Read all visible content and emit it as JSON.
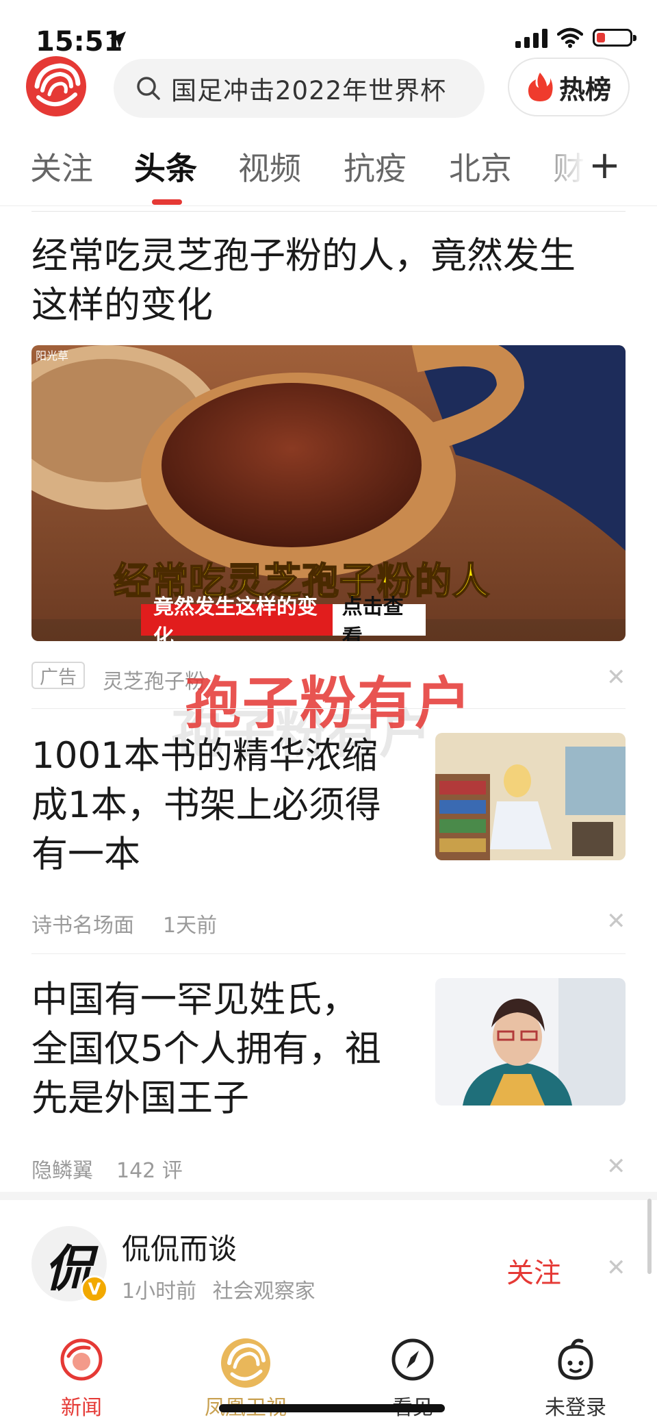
{
  "status_bar": {
    "time": "15:51"
  },
  "header": {
    "search_placeholder": "国足冲击2022年世界杯",
    "hot_label": "热榜"
  },
  "tabs": [
    {
      "label": "关注"
    },
    {
      "label": "头条"
    },
    {
      "label": "视频"
    },
    {
      "label": "抗疫"
    },
    {
      "label": "北京"
    },
    {
      "label": "财"
    }
  ],
  "active_tab": "头条",
  "feed": {
    "ad": {
      "title_line1": "经常吃灵芝孢子粉的人，竟然发生",
      "title_line2": "这样的变化",
      "image_watermark": "阳光草",
      "image_caption_main": "经常吃灵芝孢子粉的人",
      "image_caption_sub": "竟然发生这样的变化",
      "image_cta": "点击查看",
      "badge": "广告",
      "source": "灵芝孢子粉"
    },
    "overlay_text": "孢子粉有户",
    "articles": [
      {
        "title_lines": [
          "1001本书的精华浓缩",
          "成1本，书架上必须得",
          "有一本"
        ],
        "source": "诗书名场面",
        "time": "1天前"
      },
      {
        "title_lines": [
          "中国有一罕见姓氏，",
          "全国仅5个人拥有，祖",
          "先是外国王子"
        ],
        "source": "隐鳞翼",
        "comments": "142 评"
      }
    ],
    "follow_card": {
      "avatar_glyph": "侃",
      "name": "侃侃而谈",
      "time": "1小时前",
      "tag": "社会观察家",
      "follow_label": "关注"
    }
  },
  "bottom_nav": [
    {
      "label": "新闻",
      "icon": "news-icon",
      "active": true
    },
    {
      "label": "凤凰卫视",
      "icon": "phoenix-tv-icon",
      "active": false
    },
    {
      "label": "看见",
      "icon": "compass-icon",
      "active": false
    },
    {
      "label": "未登录",
      "icon": "user-icon",
      "active": false
    }
  ],
  "colors": {
    "accent": "#e53935",
    "badge": "#f2a900"
  }
}
